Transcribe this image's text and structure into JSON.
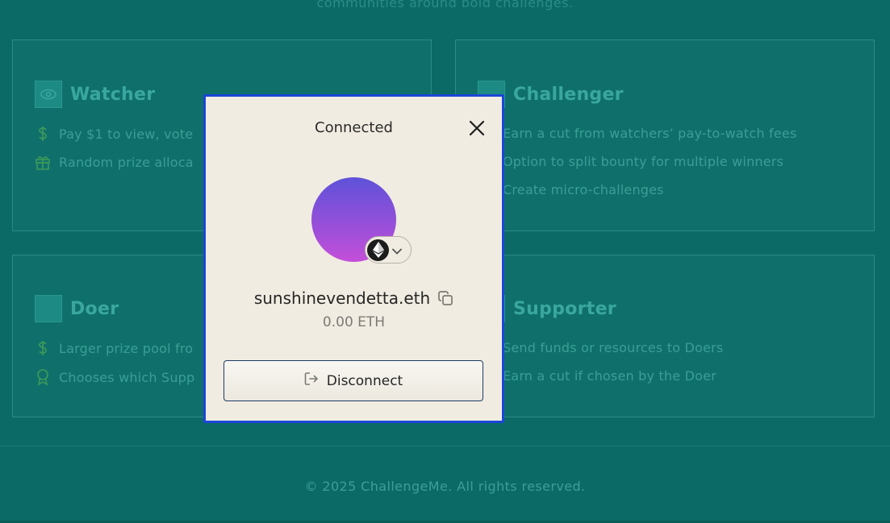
{
  "background": {
    "intro_text": "communities around bold challenges.",
    "footer": "© 2025 ChallengeMe. All rights reserved.",
    "cards": {
      "watcher": {
        "title": "Watcher",
        "icon": "eye-icon",
        "lines": [
          {
            "icon": "dollar-icon",
            "text": "Pay $1 to view, vote"
          },
          {
            "icon": "gift-icon",
            "text": "Random prize alloca"
          }
        ]
      },
      "challenger": {
        "title": "Challenger",
        "icon": "target-icon",
        "lines": [
          {
            "text": "Earn a cut from watchers’ pay-to-watch fees"
          },
          {
            "text": "Option to split bounty for multiple winners"
          },
          {
            "text": "Create micro-challenges"
          }
        ]
      },
      "doer": {
        "title": "Doer",
        "icon": "person-icon",
        "lines": [
          {
            "icon": "dollar-icon",
            "text": "Larger prize pool fro"
          },
          {
            "icon": "award-icon",
            "text": "Chooses which Supp"
          }
        ]
      },
      "supporter": {
        "title": "Supporter",
        "icon": "hand-icon",
        "lines": [
          {
            "text": "Send funds or resources to Doers"
          },
          {
            "text": "Earn a cut if chosen by the Doer"
          }
        ]
      }
    }
  },
  "modal": {
    "title": "Connected",
    "ens_name": "sunshinevendetta.eth",
    "balance": "0.00 ETH",
    "disconnect_label": "Disconnect",
    "chain_icon": "ethereum-icon",
    "accent_border": "#1b46d8"
  }
}
